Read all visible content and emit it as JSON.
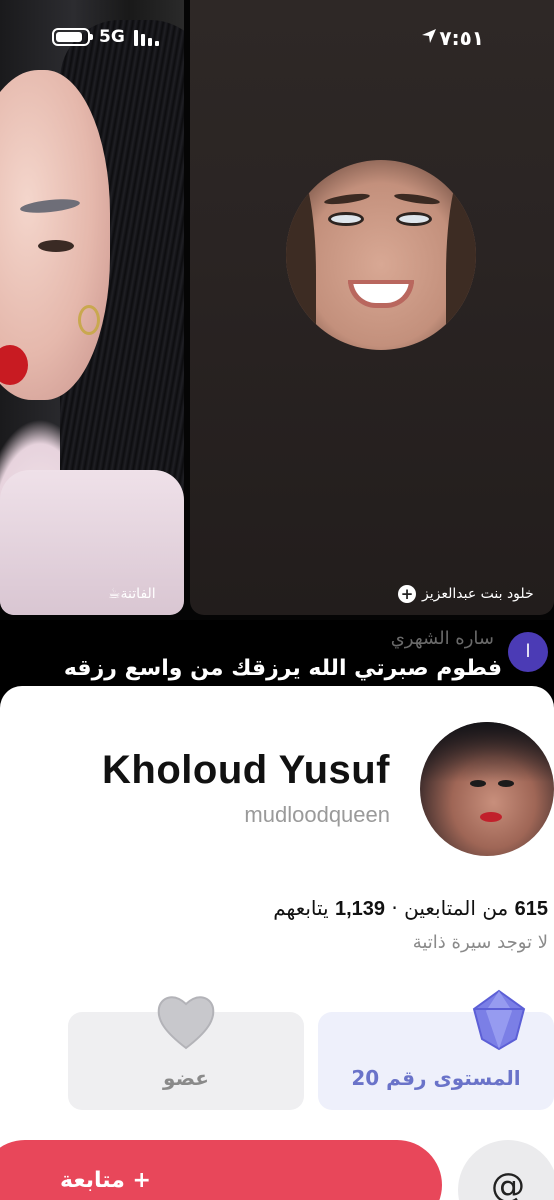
{
  "status_bar": {
    "time": "٧:٥١",
    "network": "5G"
  },
  "video_tiles": {
    "left": {
      "label": "الفاتنة☕"
    },
    "right": {
      "label": "خلود بنت عبدالعزيز"
    }
  },
  "chat": {
    "sender": "ساره الشهري",
    "message": "فطوم صبرتي الله يرزقك من واسع رزقه",
    "avatar_letter": "ا"
  },
  "profile": {
    "name": "Kholoud Yusuf",
    "handle": "mudloodqueen",
    "followers_count": "615",
    "followers_label": "من المتابعين",
    "separator": "·",
    "following_count": "1,139",
    "following_label": "يتابعهم",
    "bio": "لا توجد سيرة ذاتية",
    "level_label": "المستوى رقم 20",
    "member_label": "عضو",
    "follow_button": "+ متابعة",
    "mention_icon": "@"
  },
  "colors": {
    "accent_red": "#e8475a",
    "level_purple": "#6a73c9",
    "level_bg": "#eef0fb",
    "member_bg": "#efeff1"
  }
}
